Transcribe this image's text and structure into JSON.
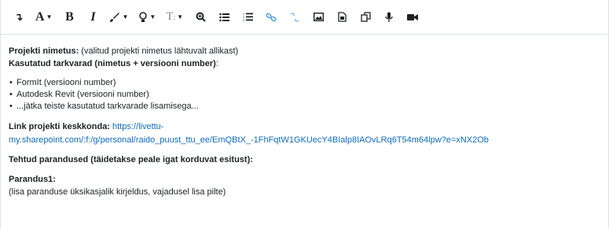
{
  "toolbar": {
    "items": [
      {
        "name": "paragraph-icon",
        "glyph": "↴"
      },
      {
        "name": "font-icon",
        "glyph": "A"
      },
      {
        "name": "bold-icon",
        "glyph": "B"
      },
      {
        "name": "italic-icon",
        "glyph": "I"
      },
      {
        "name": "brush-icon",
        "glyph": "✎"
      },
      {
        "name": "highlight-icon",
        "glyph": "♀"
      },
      {
        "name": "text-size-icon",
        "glyph": "Tɪ"
      },
      {
        "name": "zoom-icon",
        "glyph": "⊕"
      },
      {
        "name": "unordered-list-icon",
        "glyph": "☰"
      },
      {
        "name": "ordered-list-icon",
        "glyph": "☷"
      },
      {
        "name": "link-icon",
        "glyph": "🔗"
      },
      {
        "name": "unlink-icon",
        "glyph": "⛓"
      },
      {
        "name": "image-icon",
        "glyph": "▣"
      },
      {
        "name": "media-icon",
        "glyph": "▤"
      },
      {
        "name": "copy-icon",
        "glyph": "⧉"
      },
      {
        "name": "microphone-icon",
        "glyph": "🎙"
      },
      {
        "name": "video-icon",
        "glyph": "■"
      }
    ]
  },
  "content": {
    "project_name_label": "Projekti nimetus:",
    "project_name_text": " (valitud projekti nimetus lähtuvalt allikast)",
    "software_label": "Kasutatud tarkvarad (nimetus + versiooni number)",
    "software_colon": ":",
    "software_list": [
      "FormIt (versiooni number)",
      "Autodesk Revit (versiooni number)",
      "...jätka teiste kasutatud tarkvarade lisamisega..."
    ],
    "link_label": "Link projekti keskkonda:",
    "link_url_line1": "https://livettu-",
    "link_url_line2": "my.sharepoint.com/:f:/g/personal/raido_puust_ttu_ee/EmQBtX_-1FhFqtW1GKUecY4BIalp8IAOvLRq6T54m64lpw?e=xNX2Ob",
    "fixes_heading": "Tehtud parandused (täidetakse peale igat korduvat esitust):",
    "fix1_label": "Parandus1:",
    "fix1_text": "(lisa paranduse üksikasjalik kirjeldus, vajadusel lisa pilte)"
  }
}
